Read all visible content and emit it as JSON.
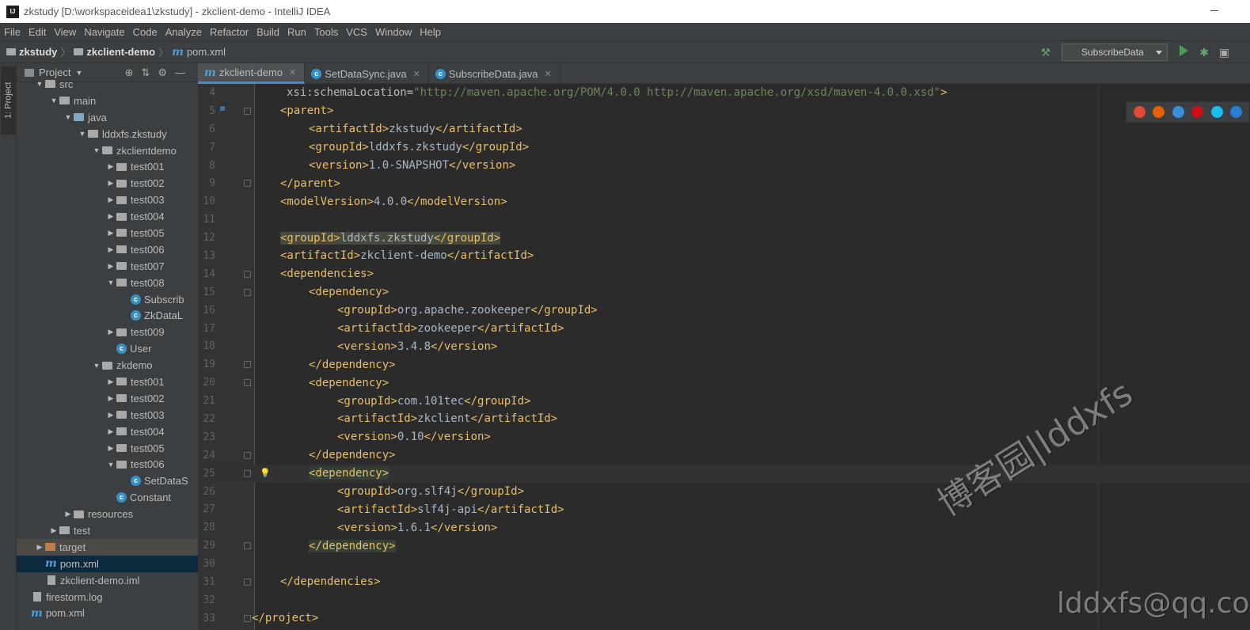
{
  "window": {
    "title": "zkstudy [D:\\workspaceidea1\\zkstudy] - zkclient-demo - IntelliJ IDEA",
    "logo": "IJ"
  },
  "menu": [
    "File",
    "Edit",
    "View",
    "Navigate",
    "Code",
    "Analyze",
    "Refactor",
    "Build",
    "Run",
    "Tools",
    "VCS",
    "Window",
    "Help"
  ],
  "breadcrumb": {
    "project": "zkstudy",
    "module": "zkclient-demo",
    "file": "pom.xml"
  },
  "toolbar": {
    "run_config": "SubscribeData"
  },
  "sidebar": {
    "tab_label": "1: Project"
  },
  "project_panel": {
    "title": "Project"
  },
  "tree": [
    {
      "label": "src",
      "depth": 2,
      "kind": "folder",
      "arrow": "▼"
    },
    {
      "label": "main",
      "depth": 3,
      "kind": "folder",
      "arrow": "▼"
    },
    {
      "label": "java",
      "depth": 4,
      "kind": "blue",
      "arrow": "▼"
    },
    {
      "label": "lddxfs.zkstudy",
      "depth": 5,
      "kind": "pkg",
      "arrow": "▼"
    },
    {
      "label": "zkclientdemo",
      "depth": 6,
      "kind": "pkg",
      "arrow": "▼"
    },
    {
      "label": "test001",
      "depth": 7,
      "kind": "pkg",
      "arrow": "▶"
    },
    {
      "label": "test002",
      "depth": 7,
      "kind": "pkg",
      "arrow": "▶"
    },
    {
      "label": "test003",
      "depth": 7,
      "kind": "pkg",
      "arrow": "▶"
    },
    {
      "label": "test004",
      "depth": 7,
      "kind": "pkg",
      "arrow": "▶"
    },
    {
      "label": "test005",
      "depth": 7,
      "kind": "pkg",
      "arrow": "▶"
    },
    {
      "label": "test006",
      "depth": 7,
      "kind": "pkg",
      "arrow": "▶"
    },
    {
      "label": "test007",
      "depth": 7,
      "kind": "pkg",
      "arrow": "▶"
    },
    {
      "label": "test008",
      "depth": 7,
      "kind": "pkg",
      "arrow": "▼"
    },
    {
      "label": "Subscrib",
      "depth": 8,
      "kind": "class",
      "arrow": ""
    },
    {
      "label": "ZkDataL",
      "depth": 8,
      "kind": "class",
      "arrow": ""
    },
    {
      "label": "test009",
      "depth": 7,
      "kind": "pkg",
      "arrow": "▶"
    },
    {
      "label": "User",
      "depth": 7,
      "kind": "class",
      "arrow": ""
    },
    {
      "label": "zkdemo",
      "depth": 6,
      "kind": "pkg",
      "arrow": "▼"
    },
    {
      "label": "test001",
      "depth": 7,
      "kind": "pkg",
      "arrow": "▶"
    },
    {
      "label": "test002",
      "depth": 7,
      "kind": "pkg",
      "arrow": "▶"
    },
    {
      "label": "test003",
      "depth": 7,
      "kind": "pkg",
      "arrow": "▶"
    },
    {
      "label": "test004",
      "depth": 7,
      "kind": "pkg",
      "arrow": "▶"
    },
    {
      "label": "test005",
      "depth": 7,
      "kind": "pkg",
      "arrow": "▶"
    },
    {
      "label": "test006",
      "depth": 7,
      "kind": "pkg",
      "arrow": "▼"
    },
    {
      "label": "SetDataS",
      "depth": 8,
      "kind": "class",
      "arrow": ""
    },
    {
      "label": "Constant",
      "depth": 7,
      "kind": "class",
      "arrow": ""
    },
    {
      "label": "resources",
      "depth": 4,
      "kind": "folder",
      "arrow": "▶"
    },
    {
      "label": "test",
      "depth": 3,
      "kind": "folder",
      "arrow": "▶"
    },
    {
      "label": "target",
      "depth": 2,
      "kind": "orange",
      "arrow": "▶",
      "state": "target"
    },
    {
      "label": "pom.xml",
      "depth": 2,
      "kind": "maven",
      "arrow": "",
      "state": "selected"
    },
    {
      "label": "zkclient-demo.iml",
      "depth": 2,
      "kind": "file",
      "arrow": ""
    },
    {
      "label": "firestorm.log",
      "depth": 1,
      "kind": "file",
      "arrow": ""
    },
    {
      "label": "pom.xml",
      "depth": 1,
      "kind": "maven",
      "arrow": ""
    }
  ],
  "tabs": [
    {
      "label": "zkclient-demo",
      "icon": "maven",
      "active": true
    },
    {
      "label": "SetDataSync.java",
      "icon": "class",
      "active": false
    },
    {
      "label": "SubscribeData.java",
      "icon": "class",
      "active": false
    }
  ],
  "code_lines": [
    {
      "n": "4",
      "indent": 1,
      "parts": [
        [
          "attr",
          "xsi:schemaLocation="
        ],
        [
          "val",
          "\"http://maven.apache.org/POM/4.0.0 http://maven.apache.org/xsd/maven-4.0.0.xsd\""
        ],
        [
          "tagc",
          ">"
        ]
      ]
    },
    {
      "n": "5",
      "indent": 1,
      "parts": [
        [
          "tagc",
          "<parent>"
        ]
      ],
      "fold": true,
      "mfold": "m↑"
    },
    {
      "n": "6",
      "indent": 2,
      "parts": [
        [
          "tagc",
          "<artifactId>"
        ],
        [
          "txt",
          "zkstudy"
        ],
        [
          "tagc",
          "</artifactId>"
        ]
      ]
    },
    {
      "n": "7",
      "indent": 2,
      "parts": [
        [
          "tagc",
          "<groupId>"
        ],
        [
          "txt",
          "lddxfs.zkstudy"
        ],
        [
          "tagc",
          "</groupId>"
        ]
      ]
    },
    {
      "n": "8",
      "indent": 2,
      "parts": [
        [
          "tagc",
          "<version>"
        ],
        [
          "txt",
          "1.0-SNAPSHOT"
        ],
        [
          "tagc",
          "</version>"
        ]
      ]
    },
    {
      "n": "9",
      "indent": 1,
      "parts": [
        [
          "tagc",
          "</parent>"
        ]
      ],
      "fold": true
    },
    {
      "n": "10",
      "indent": 1,
      "parts": [
        [
          "tagc",
          "<modelVersion>"
        ],
        [
          "txt",
          "4.0.0"
        ],
        [
          "tagc",
          "</modelVersion>"
        ]
      ]
    },
    {
      "n": "11",
      "indent": 1,
      "parts": []
    },
    {
      "n": "12",
      "indent": 1,
      "parts": [
        [
          "tagc",
          "<groupId>"
        ],
        [
          "txt",
          "lddxfs.zkstudy"
        ],
        [
          "tagc",
          "</groupId>"
        ]
      ],
      "hl": true
    },
    {
      "n": "13",
      "indent": 1,
      "parts": [
        [
          "tagc",
          "<artifactId>"
        ],
        [
          "txt",
          "zkclient-demo"
        ],
        [
          "tagc",
          "</artifactId>"
        ]
      ]
    },
    {
      "n": "14",
      "indent": 1,
      "parts": [
        [
          "tagc",
          "<dependencies>"
        ]
      ],
      "fold": true
    },
    {
      "n": "15",
      "indent": 2,
      "parts": [
        [
          "tagc",
          "<dependency>"
        ]
      ],
      "fold": true
    },
    {
      "n": "16",
      "indent": 3,
      "parts": [
        [
          "tagc",
          "<groupId>"
        ],
        [
          "txt",
          "org.apache.zookeeper"
        ],
        [
          "tagc",
          "</groupId>"
        ]
      ]
    },
    {
      "n": "17",
      "indent": 3,
      "parts": [
        [
          "tagc",
          "<artifactId>"
        ],
        [
          "txt",
          "zookeeper"
        ],
        [
          "tagc",
          "</artifactId>"
        ]
      ]
    },
    {
      "n": "18",
      "indent": 3,
      "parts": [
        [
          "tagc",
          "<version>"
        ],
        [
          "txt",
          "3.4.8"
        ],
        [
          "tagc",
          "</version>"
        ]
      ]
    },
    {
      "n": "19",
      "indent": 2,
      "parts": [
        [
          "tagc",
          "</dependency>"
        ]
      ],
      "fold": true
    },
    {
      "n": "20",
      "indent": 2,
      "parts": [
        [
          "tagc",
          "<dependency>"
        ]
      ],
      "fold": true
    },
    {
      "n": "21",
      "indent": 3,
      "parts": [
        [
          "tagc",
          "<groupId>"
        ],
        [
          "txt",
          "com.101tec"
        ],
        [
          "tagc",
          "</groupId>"
        ]
      ]
    },
    {
      "n": "22",
      "indent": 3,
      "parts": [
        [
          "tagc",
          "<artifactId>"
        ],
        [
          "txt",
          "zkclient"
        ],
        [
          "tagc",
          "</artifactId>"
        ]
      ]
    },
    {
      "n": "23",
      "indent": 3,
      "parts": [
        [
          "tagc",
          "<version>"
        ],
        [
          "txt",
          "0.10"
        ],
        [
          "tagc",
          "</version>"
        ]
      ]
    },
    {
      "n": "24",
      "indent": 2,
      "parts": [
        [
          "tagc",
          "</dependency>"
        ]
      ],
      "fold": true
    },
    {
      "n": "25",
      "indent": 2,
      "parts": [
        [
          "tagc",
          "<dependency>"
        ]
      ],
      "fold": true,
      "cur": true,
      "hl2": true,
      "bulb": true
    },
    {
      "n": "26",
      "indent": 3,
      "parts": [
        [
          "tagc",
          "<groupId>"
        ],
        [
          "txt",
          "org.slf4j"
        ],
        [
          "tagc",
          "</groupId>"
        ]
      ]
    },
    {
      "n": "27",
      "indent": 3,
      "parts": [
        [
          "tagc",
          "<artifactId>"
        ],
        [
          "txt",
          "slf4j-api"
        ],
        [
          "tagc",
          "</artifactId>"
        ]
      ]
    },
    {
      "n": "28",
      "indent": 3,
      "parts": [
        [
          "tagc",
          "<version>"
        ],
        [
          "txt",
          "1.6.1"
        ],
        [
          "tagc",
          "</version>"
        ]
      ]
    },
    {
      "n": "29",
      "indent": 2,
      "parts": [
        [
          "tagc",
          "</dependency>"
        ]
      ],
      "fold": true,
      "hl2": true
    },
    {
      "n": "30",
      "indent": 1,
      "parts": []
    },
    {
      "n": "31",
      "indent": 1,
      "parts": [
        [
          "tagc",
          "</dependencies>"
        ]
      ],
      "fold": true
    },
    {
      "n": "32",
      "indent": 1,
      "parts": []
    },
    {
      "n": "33",
      "indent": 0,
      "parts": [
        [
          "tagc",
          "</project>"
        ]
      ],
      "fold": true
    }
  ],
  "browsers": [
    {
      "name": "chrome-icon",
      "color": "#dd4b39"
    },
    {
      "name": "firefox-icon",
      "color": "#e66000"
    },
    {
      "name": "safari-icon",
      "color": "#3b8fd9"
    },
    {
      "name": "opera-icon",
      "color": "#cc0f16"
    },
    {
      "name": "ie-icon",
      "color": "#1ebbee"
    },
    {
      "name": "edge-icon",
      "color": "#2b7cd3"
    }
  ],
  "watermark": {
    "line1": "博客园|lddxfs",
    "line2": "lddxfs@qq.com"
  }
}
